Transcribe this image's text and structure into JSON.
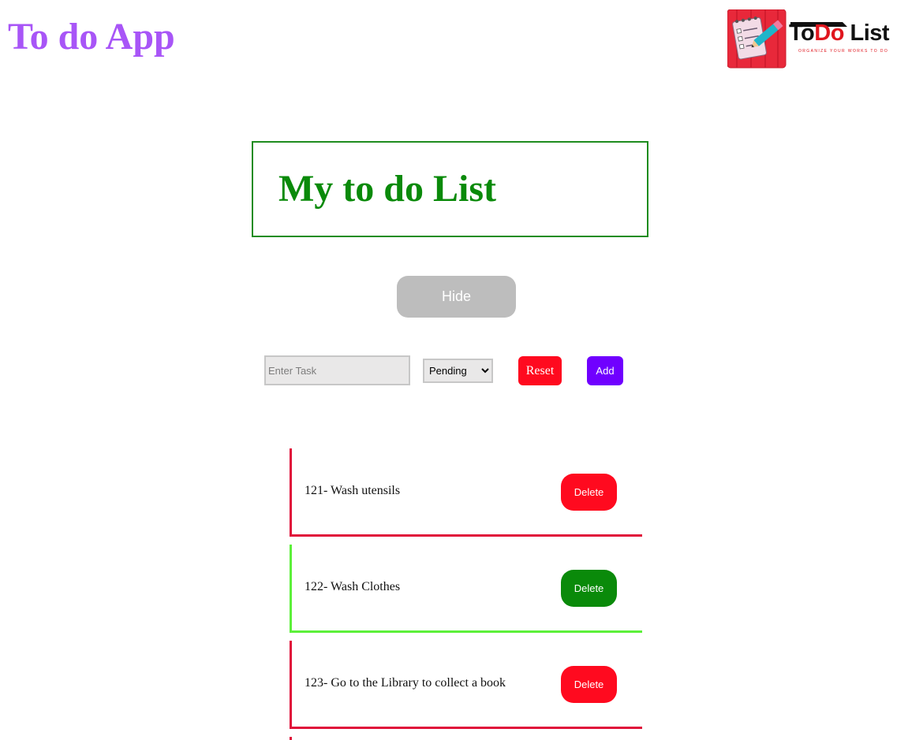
{
  "header": {
    "app_title": "To do App",
    "logo": {
      "wordmark_part1": "To",
      "wordmark_part2": "Do",
      "wordmark_part3": " List",
      "tagline": "ORGANIZE YOUR WORKS TO DO",
      "icon": "notepad-pencil-icon"
    }
  },
  "main": {
    "list_title": "My to do List",
    "hide_button_label": "Hide"
  },
  "form": {
    "task_placeholder": "Enter Task",
    "task_value": "",
    "status_options": [
      "Pending"
    ],
    "status_selected": "Pending",
    "reset_label": "Reset",
    "add_label": "Add"
  },
  "tasks": [
    {
      "text": "121- Wash utensils",
      "status": "pending",
      "delete_label": "Delete"
    },
    {
      "text": "122- Wash Clothes",
      "status": "done",
      "delete_label": "Delete"
    },
    {
      "text": "123- Go to the Library to collect a book",
      "status": "pending",
      "delete_label": "Delete"
    }
  ],
  "colors": {
    "app_title": "#a855f7",
    "list_title": "#0a8a0a",
    "pending_accent": "#e0103a",
    "done_accent": "#5cf03a",
    "danger": "#ff0a1f",
    "success": "#0a8a0a",
    "add": "#7000ff",
    "hide": "#bdbdbd"
  }
}
